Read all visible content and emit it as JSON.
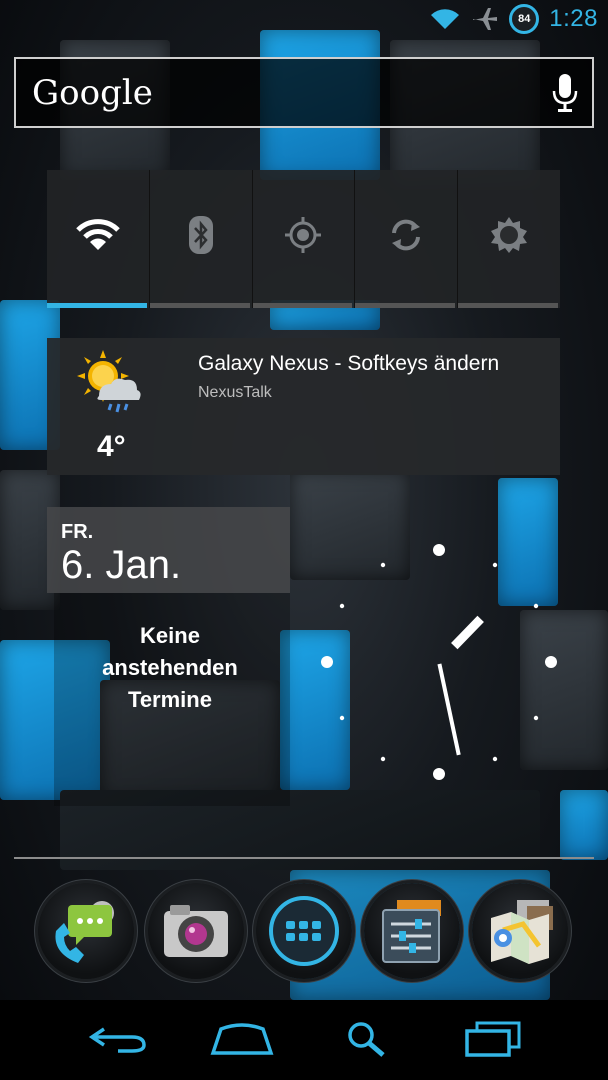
{
  "status_bar": {
    "time": "1:28",
    "battery_level": "84",
    "icons": [
      "wifi-icon",
      "airplane-mode-icon",
      "battery-icon"
    ],
    "accent_color": "#33b5e5"
  },
  "search": {
    "logo_text": "Google",
    "voice_icon": "mic-icon"
  },
  "power_control": {
    "toggles": [
      {
        "name": "wifi",
        "icon": "wifi-icon",
        "on": true
      },
      {
        "name": "bluetooth",
        "icon": "bluetooth-icon",
        "on": false
      },
      {
        "name": "gps",
        "icon": "gps-icon",
        "on": false
      },
      {
        "name": "sync",
        "icon": "sync-icon",
        "on": false
      },
      {
        "name": "brightness",
        "icon": "brightness-icon",
        "on": false
      }
    ]
  },
  "news_weather": {
    "temperature": "4°",
    "weather_icon": "sun-cloud-rain-icon",
    "headline": "Galaxy Nexus - Softkeys ändern",
    "source": "NexusTalk"
  },
  "calendar": {
    "day": "FR.",
    "date": "6. Jan.",
    "empty_text_line1": "Keine",
    "empty_text_line2": "anstehenden",
    "empty_text_line3": "Termine"
  },
  "clock": {
    "hour": 1,
    "minute": 28
  },
  "dock": {
    "items": [
      {
        "name": "phone-messaging-folder",
        "icon": "phone-chat-icon"
      },
      {
        "name": "camera",
        "icon": "camera-icon"
      },
      {
        "name": "all-apps",
        "icon": "app-drawer-icon"
      },
      {
        "name": "settings",
        "icon": "settings-sliders-icon"
      },
      {
        "name": "maps-folder",
        "icon": "maps-icon"
      }
    ]
  },
  "nav_bar": {
    "buttons": [
      "back-icon",
      "home-icon",
      "search-icon",
      "recent-apps-icon"
    ]
  }
}
